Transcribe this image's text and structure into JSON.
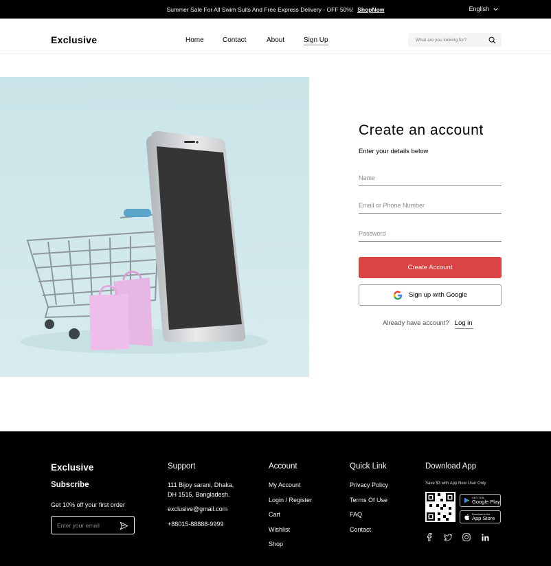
{
  "topbar": {
    "promo": "Summer Sale For All Swim Suits And Free Express Delivery - OFF 50%!",
    "shop_now": "ShopNow",
    "language": "English"
  },
  "header": {
    "logo": "Exclusive",
    "nav": [
      "Home",
      "Contact",
      "About",
      "Sign Up"
    ],
    "search_placeholder": "What are you looking for?"
  },
  "form": {
    "title": "Create an account",
    "subtitle": "Enter your details below",
    "name_placeholder": "Name",
    "email_placeholder": "Email or Phone Number",
    "password_placeholder": "Password",
    "create_label": "Create Account",
    "google_label": "Sign up with Google",
    "have_account": "Already have account?",
    "login_label": "Log in"
  },
  "footer": {
    "brand": "Exclusive",
    "subscribe_title": "Subscribe",
    "subscribe_text": "Get 10% off your first order",
    "email_placeholder": "Enter your email",
    "support": {
      "title": "Support",
      "address_line1": "111 Bijoy sarani, Dhaka,",
      "address_line2": "DH 1515, Bangladesh.",
      "email": "exclusive@gmail.com",
      "phone": "+88015-88888-9999"
    },
    "account": {
      "title": "Account",
      "links": [
        "My Account",
        "Login / Register",
        "Cart",
        "Wishlist",
        "Shop"
      ]
    },
    "quick": {
      "title": "Quick Link",
      "links": [
        "Privacy Policy",
        "Terms Of Use",
        "FAQ",
        "Contact"
      ]
    },
    "download": {
      "title": "Download App",
      "note": "Save $3 with App New User Only",
      "google_small": "GET IT ON",
      "google_big": "Google Play",
      "apple_small": "Download on the",
      "apple_big": "App Store"
    }
  }
}
